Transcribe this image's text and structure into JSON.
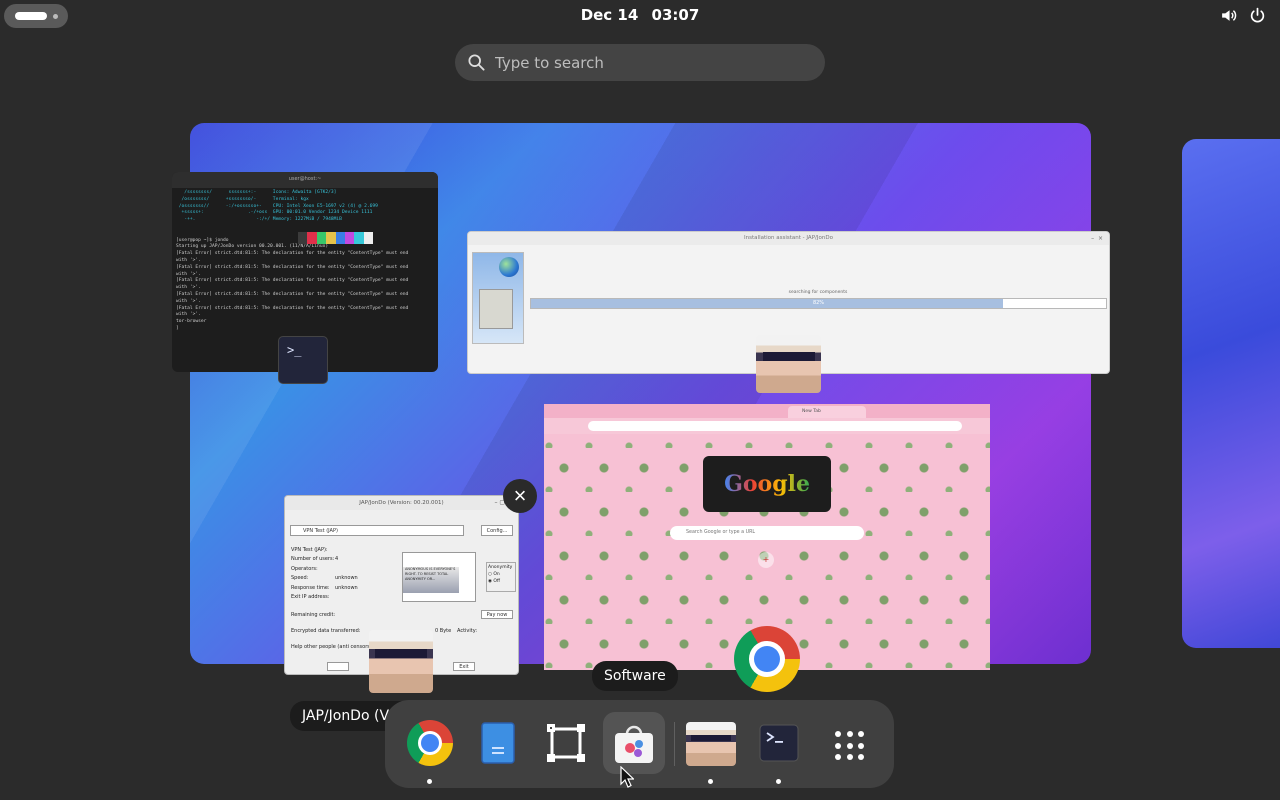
{
  "topbar": {
    "date": "Dec 14",
    "time": "03:07",
    "icons": [
      "volume-icon",
      "power-icon"
    ]
  },
  "search": {
    "placeholder": "Type to search"
  },
  "windows": {
    "terminal": {
      "title": "user@host:~",
      "lines": [
        "   /ssssssss/      sssssss+:-      Icons: Adwaita [GTK2/3]",
        "  /osssssss/      +ssssssso/-      Terminal: kgx",
        " /osssssss//      -:/+ossssso+-    CPU: Intel Xeon E5-1697 v2 (4) @ 2.699",
        "  +sssss+:                .-/+oss  GPU: 00:01.0 Vendor 1234 Device 1111",
        "   -++.                      -:/+/ Memory: 1227MiB / 7948MiB",
        "",
        "",
        "[user@pop ~]$ jondo",
        "Starting up JAP/JonDo version 00.20.001. (11/N/A/Linux)",
        "[Fatal Error] strict.dtd:81:5: The declaration for the entity \"ContentType\" must end",
        "with '>'.",
        "[Fatal Error] strict.dtd:81:5: The declaration for the entity \"ContentType\" must end",
        "with '>'.",
        "[Fatal Error] strict.dtd:81:5: The declaration for the entity \"ContentType\" must end",
        "with '>'.",
        "[Fatal Error] strict.dtd:81:5: The declaration for the entity \"ContentType\" must end",
        "with '>'.",
        "[Fatal Error] strict.dtd:81:5: The declaration for the entity \"ContentType\" must end",
        "with '>'.",
        "tor-browser",
        "]"
      ]
    },
    "installer": {
      "title": "Installation assistant - JAP/JonDo",
      "status": "searching for components",
      "progress_percent": 82,
      "progress_label": "82%"
    },
    "chrome": {
      "tab_label": "New Tab",
      "logo_text": "Google",
      "search_placeholder": "Search Google or type a URL"
    },
    "jap": {
      "title": "JAP/JonDo (Version: 00.20.001)",
      "service": "VPN Test (JAP)",
      "config_label": "Config...",
      "info_heading": "VPN Test (JAP):",
      "fields": [
        {
          "label": "Number of users:",
          "value": "4"
        },
        {
          "label": "Operators:",
          "value": ""
        },
        {
          "label": "Speed:",
          "value": "unknown"
        },
        {
          "label": "Response time:",
          "value": "unknown"
        },
        {
          "label": "Exit IP address:",
          "value": ""
        }
      ],
      "ad_text": "ANONYMOUS IS EVERYONE'S RIGHT. TO RESIST TOTAL ANONYMITY OR...",
      "anonymity_label": "Anonymity",
      "anon_on": "On",
      "anon_off": "Off",
      "remaining_label": "Remaining credit:",
      "pay_label": "Pay now",
      "encrypted_label": "Encrypted data transferred:",
      "encrypted_value": "0 Byte",
      "activity_label": "Activity:",
      "help_label": "Help other people (anti censorship)",
      "exit_label": "Exit"
    }
  },
  "tooltips": {
    "software": "Software",
    "jap_window": "JAP/JonDo (Version: 00.20.…"
  },
  "dash": {
    "items": [
      {
        "name": "Google Chrome",
        "icon": "chrome-icon",
        "running": true
      },
      {
        "name": "Text Editor",
        "icon": "text-editor-icon",
        "running": false
      },
      {
        "name": "Screenshot",
        "icon": "screenshot-icon",
        "running": false
      },
      {
        "name": "Software",
        "icon": "software-icon",
        "running": false
      },
      {
        "name": "JAP/JonDo",
        "icon": "jondo-icon",
        "running": true
      },
      {
        "name": "Terminal",
        "icon": "terminal-icon",
        "running": true
      },
      {
        "name": "Show Apps",
        "icon": "apps-grid-icon",
        "running": false
      }
    ]
  }
}
